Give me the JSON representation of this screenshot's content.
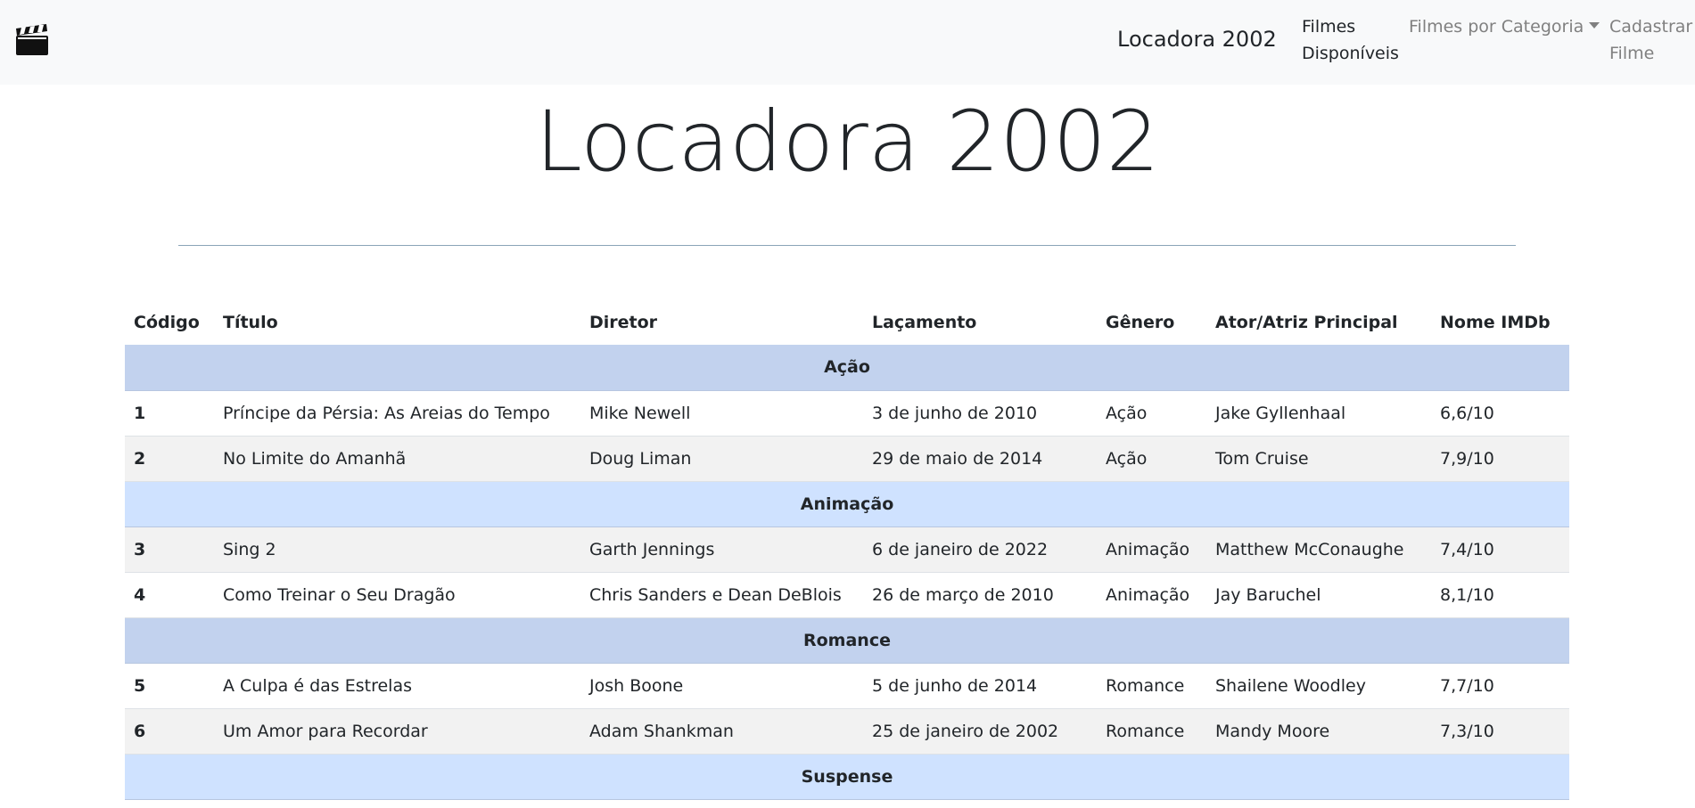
{
  "navbar": {
    "icon": "clapperboard-icon",
    "brand": "Locadora 2002",
    "links": [
      {
        "line1": "Filmes",
        "line2": "Disponíveis"
      },
      {
        "label": "Filmes por Categoria"
      },
      {
        "line1": "Cadastrar",
        "line2": "Filme"
      }
    ]
  },
  "page": {
    "title": "Locadora 2002"
  },
  "table": {
    "headers": [
      "Código",
      "Título",
      "Diretor",
      "Laçamento",
      "Gênero",
      "Ator/Atriz Principal",
      "Nome IMDb"
    ],
    "groups": [
      {
        "name": "Ação",
        "rows": [
          [
            "1",
            "Príncipe da Pérsia: As Areias do Tempo",
            "Mike Newell",
            "3 de junho de 2010",
            "Ação",
            "Jake Gyllenhaal",
            "6,6/10"
          ],
          [
            "2",
            "No Limite do Amanhã",
            "Doug Liman",
            "29 de maio de 2014",
            "Ação",
            "Tom Cruise",
            "7,9/10"
          ]
        ]
      },
      {
        "name": "Animação",
        "rows": [
          [
            "3",
            "Sing 2",
            "Garth Jennings",
            "6 de janeiro de 2022",
            "Animação",
            "Matthew McConaughe",
            "7,4/10"
          ],
          [
            "4",
            "Como Treinar o Seu Dragão",
            "Chris Sanders e Dean DeBlois",
            "26 de março de 2010",
            "Animação",
            "Jay Baruchel",
            "8,1/10"
          ]
        ]
      },
      {
        "name": "Romance",
        "rows": [
          [
            "5",
            "A Culpa é das Estrelas",
            "Josh Boone",
            "5 de junho de 2014",
            "Romance",
            "Shailene Woodley",
            "7,7/10"
          ],
          [
            "6",
            "Um Amor para Recordar",
            "Adam Shankman",
            "25 de janeiro de 2002",
            "Romance",
            "Mandy Moore",
            "7,3/10"
          ]
        ]
      },
      {
        "name": "Suspense",
        "rows": []
      }
    ]
  }
}
